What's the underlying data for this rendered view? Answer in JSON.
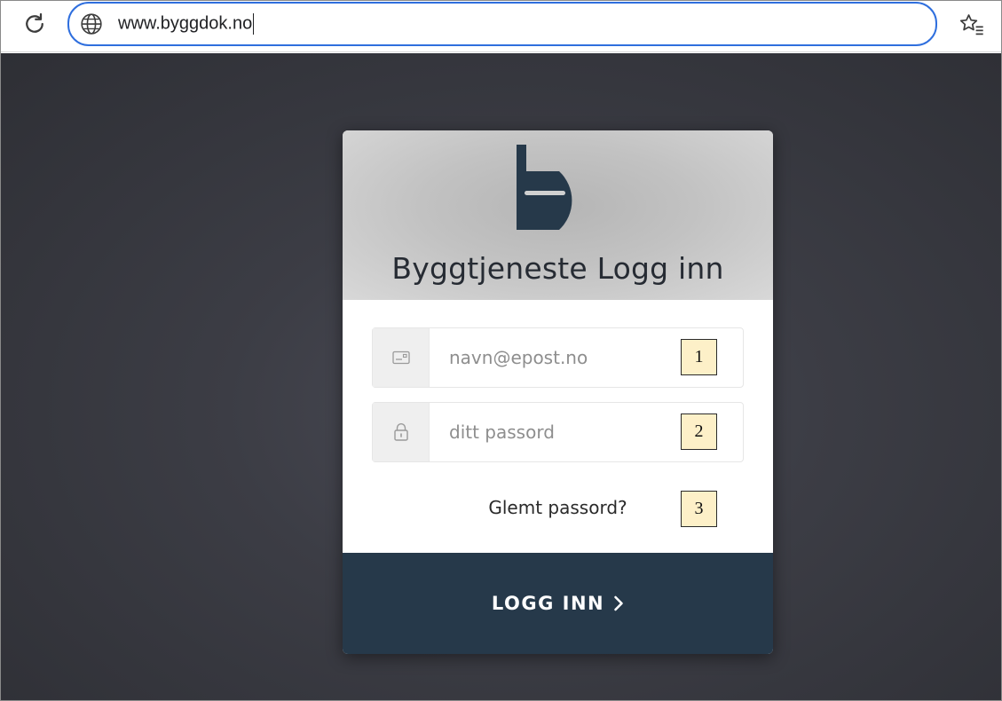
{
  "browser": {
    "url": "www.byggdok.no"
  },
  "login": {
    "title": "Byggtjeneste Logg inn",
    "email_placeholder": "navn@epost.no",
    "password_placeholder": "ditt passord",
    "forgot_label": "Glemt passord?",
    "submit_label": "LOGG INN"
  },
  "callouts": [
    "1",
    "2",
    "3"
  ],
  "colors": {
    "brand_dark": "#26394a",
    "address_bar_focus": "#2f6fde",
    "callout_fill": "#fdf0c8"
  },
  "icons": {
    "reload": "reload-icon",
    "globe": "globe-icon",
    "favorites": "favorites-star-icon",
    "email": "id-card-icon",
    "password": "lock-icon",
    "submit": "chevron-right-icon"
  }
}
